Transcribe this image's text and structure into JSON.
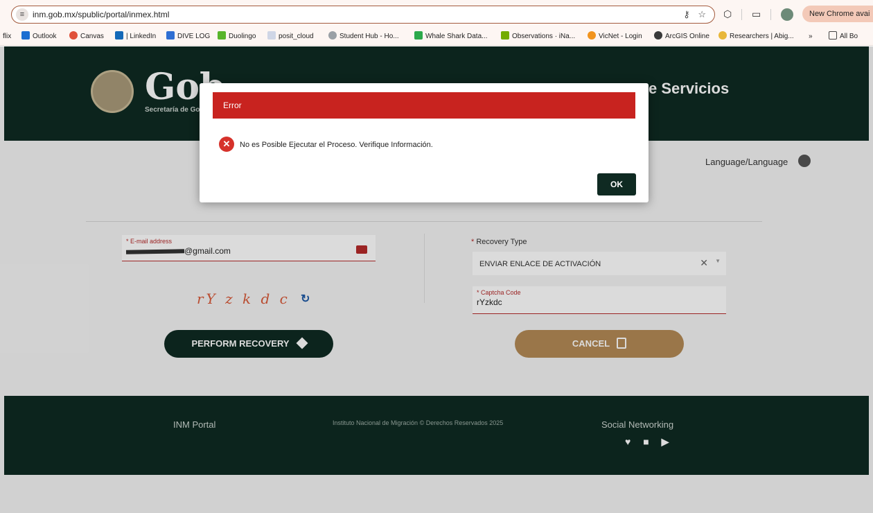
{
  "browser": {
    "url": "inm.gob.mx/spublic/portal/inmex.html",
    "update_pill": "New Chrome avai",
    "bookmarks": [
      "flix",
      "Outlook",
      "Canvas",
      "| LinkedIn",
      "DIVE LOG",
      "Duolingo",
      "posit_cloud",
      "Student Hub - Ho...",
      "Whale Shark Data...",
      "Observations · iNa...",
      "VicNet - Login",
      "ArcGIS Online",
      "Researchers | Abig...",
      "»",
      "All Bo"
    ]
  },
  "header": {
    "title": "Gob",
    "subtitle": "Secretaría de Go",
    "right_text": "e Servicios"
  },
  "language": {
    "label": "Language/Language"
  },
  "form": {
    "email": {
      "label": "E-mail address",
      "value": "@gmail.com"
    },
    "recovery_type": {
      "label": "Recovery Type",
      "value": "ENVIAR ENLACE DE ACTIVACIÓN"
    },
    "captcha": {
      "image_text": "rY z k d c",
      "label": "Captcha Code",
      "value": "rYzkdc"
    },
    "perform_label": "PERFORM RECOVERY",
    "cancel_label": "CANCEL"
  },
  "footer": {
    "portal": "INM Portal",
    "copyright": "Instituto Nacional de Migración © Derechos Reservados 2025",
    "social": "Social Networking"
  },
  "modal": {
    "title": "Error",
    "message": "No es Posible Ejecutar el Proceso. Verifique Información.",
    "ok_label": "OK"
  },
  "colors": {
    "brand_dark": "#0f2a22",
    "error_red": "#c8231f",
    "cancel_gold": "#b48a55"
  }
}
